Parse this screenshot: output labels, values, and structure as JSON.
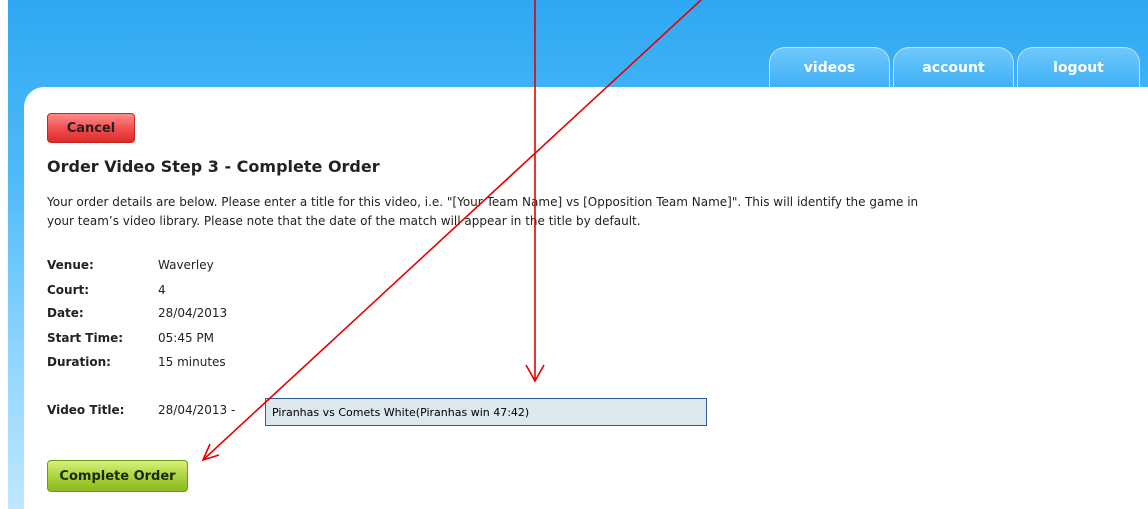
{
  "nav": {
    "tabs": [
      {
        "label": "videos"
      },
      {
        "label": "account"
      },
      {
        "label": "logout"
      }
    ]
  },
  "actions": {
    "cancel_label": "Cancel",
    "complete_label": "Complete Order"
  },
  "page": {
    "title": "Order Video Step 3 - Complete Order",
    "intro": "Your order details are below. Please enter a title for this video, i.e. \"[Your Team Name] vs [Opposition Team Name]\". This will identify the game in your team’s video library. Please note that the date of the match will appear in the title by default."
  },
  "details": [
    {
      "label": "Venue:",
      "value": "Waverley"
    },
    {
      "label": "Court:",
      "value": "4"
    },
    {
      "label": "Date:",
      "value": "28/04/2013"
    },
    {
      "label": "Start Time:",
      "value": "05:45 PM"
    },
    {
      "label": "Duration:",
      "value": "15 minutes"
    }
  ],
  "video_title": {
    "label": "Video Title:",
    "date_prefix": "28/04/2013 -",
    "value": "Piranhas vs Comets White(Piranhas win 47:42)"
  },
  "colors": {
    "annotation_arrow": "#e60000",
    "cancel_button": "#f24b4b",
    "complete_button": "#a8d13a",
    "header_sky": "#4fbaf8"
  }
}
